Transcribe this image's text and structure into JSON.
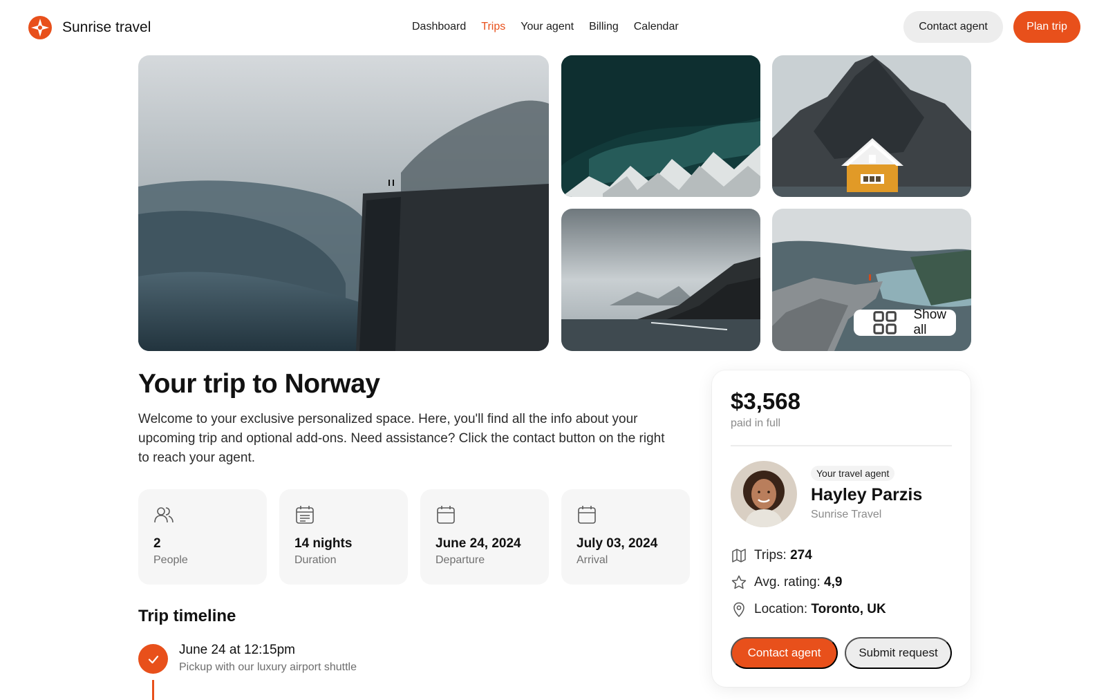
{
  "brand": {
    "name": "Sunrise travel",
    "accent": "#e8501b"
  },
  "nav": {
    "items": [
      "Dashboard",
      "Trips",
      "Your agent",
      "Billing",
      "Calendar"
    ],
    "active": "Trips"
  },
  "header": {
    "contact_label": "Contact agent",
    "plan_label": "Plan trip"
  },
  "gallery": {
    "show_all_label": "Show all"
  },
  "trip": {
    "title": "Your trip to Norway",
    "intro": "Welcome to your exclusive personalized space. Here, you'll find all the info about your upcoming trip and optional add-ons. Need assistance? Click the contact button on the right to reach your agent.",
    "stats": [
      {
        "icon": "people-icon",
        "value": "2",
        "label": "People"
      },
      {
        "icon": "calendar-list-icon",
        "value": "14 nights",
        "label": "Duration"
      },
      {
        "icon": "calendar-icon",
        "value": "June 24, 2024",
        "label": "Departure"
      },
      {
        "icon": "calendar-icon",
        "value": "July 03, 2024",
        "label": "Arrival"
      }
    ]
  },
  "timeline": {
    "title": "Trip timeline",
    "items": [
      {
        "when": "June 24 at 12:15pm",
        "what": "Pickup with our luxury airport shuttle",
        "done": true
      }
    ]
  },
  "summary": {
    "price": "$3,568",
    "price_note": "paid in full",
    "agent_tag": "Your travel agent",
    "agent_name": "Hayley Parzis",
    "agent_company": "Sunrise Travel",
    "trips_label": "Trips:",
    "trips_value": "274",
    "rating_label": "Avg. rating:",
    "rating_value": "4,9",
    "location_label": "Location:",
    "location_value": "Toronto, UK",
    "contact_label": "Contact agent",
    "submit_label": "Submit request"
  }
}
